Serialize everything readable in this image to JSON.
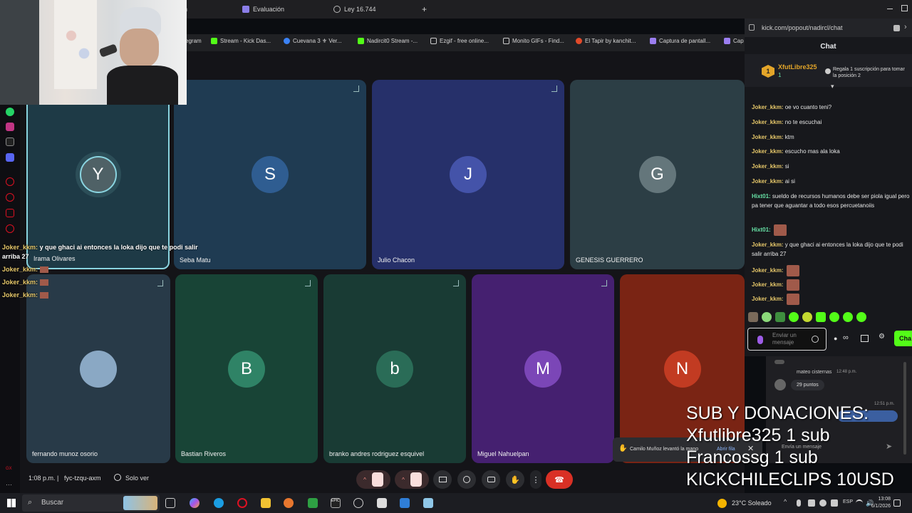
{
  "browser": {
    "tabs": [
      "n",
      "Evaluación",
      "Ley 16.744",
      "+"
    ],
    "address": "kick.com/popout/nadircl/chat",
    "bookmarks": [
      "egram",
      "Stream - Kick Das...",
      "Cuevana 3 ⚜ Ver...",
      "Nadircit0 Stream -...",
      "Ezgif - free online...",
      "Monito GIFs - Find...",
      "El Tapir by kanchit...",
      "Captura de pantall...",
      "Cap"
    ]
  },
  "meet": {
    "tiles": [
      {
        "name": "Irama Olivares",
        "initial": "Y",
        "bg": "#1e3a46",
        "avatar": "#4f6166"
      },
      {
        "name": "Seba Matu",
        "initial": "S",
        "bg": "#1f3b52",
        "avatar": "#2f5d91"
      },
      {
        "name": "Julio Chacon",
        "initial": "J",
        "bg": "#26306a",
        "avatar": "#4453a9"
      },
      {
        "name": "GENESIS GUERRERO",
        "initial": "G",
        "bg": "#2c3e45",
        "avatar": "#64767b"
      },
      {
        "name": "fernando munoz osorio",
        "initial": "",
        "bg": "#283a48",
        "avatar": "#8aa8c4"
      },
      {
        "name": "Bastian Riveros",
        "initial": "B",
        "bg": "#184436",
        "avatar": "#2f8366"
      },
      {
        "name": "branko andres rodriguez esquivel",
        "initial": "b",
        "bg": "#193b34",
        "avatar": "#2a6c57"
      },
      {
        "name": "Miguel Nahuelpan",
        "initial": "M",
        "bg": "#452070",
        "avatar": "#7b46b7"
      },
      {
        "name": "",
        "initial": "N",
        "bg": "#7a2414",
        "avatar": "#c23b22"
      }
    ],
    "time": "1:08 p.m.",
    "code": "fyc-tzqu-axm",
    "viewer": "Solo ver",
    "raise_hand_toast": "Camilo Muñoz levantó la mano",
    "toast_link": "Abrir fila",
    "side_chat": {
      "user": "mateo cisternas",
      "time1": "12:48 p.m.",
      "points": "29 puntos",
      "time2": "12:51 p.m.",
      "input": "Envía un mensaje"
    }
  },
  "overlay_chat": [
    {
      "user": "Joker_kkm:",
      "text": "y que ghaci ai entonces la loka dijo que te podi salir arriba 27"
    },
    {
      "user": "Joker_kkm:",
      "text": ""
    },
    {
      "user": "Joker_kkm:",
      "text": ""
    },
    {
      "user": "Joker_kkm:",
      "text": ""
    }
  ],
  "kick": {
    "title": "Chat",
    "top_user": "XfutLibre325",
    "top_count": "1",
    "gift_text": "Regala 1 suscripción para tomar la posición 2",
    "messages": [
      {
        "user": "Joker_kkm:",
        "text": "oe vo cuanto teni?",
        "c": "u"
      },
      {
        "user": "Joker_kkm:",
        "text": "no te escuchai",
        "c": "u"
      },
      {
        "user": "Joker_kkm:",
        "text": "ktm",
        "c": "u"
      },
      {
        "user": "Joker_kkm:",
        "text": "escucho mas ala loka",
        "c": "u"
      },
      {
        "user": "Joker_kkm:",
        "text": "si",
        "c": "u"
      },
      {
        "user": "Joker_kkm:",
        "text": "ai si",
        "c": "u"
      },
      {
        "user": "Hixt01:",
        "text": "sueldo de recursos humanos debe ser piola igual pero pa tener que aguantar a todo esos percuetanoiis",
        "c": "u2"
      },
      {
        "user": "Hixt01:",
        "text": "",
        "c": "u2"
      },
      {
        "user": "Joker_kkm:",
        "text": "y que ghaci ai entonces la loka dijo que te podi salir arriba 27",
        "c": "u"
      },
      {
        "user": "Joker_kkm:",
        "text": "",
        "c": "u"
      },
      {
        "user": "Joker_kkm:",
        "text": "",
        "c": "u"
      },
      {
        "user": "Joker_kkm:",
        "text": "",
        "c": "u"
      }
    ],
    "input_placeholder": "Enviar un mensaje",
    "send_label": "Cha"
  },
  "sub_overlay": [
    "SUB Y DONACIONES:",
    "Xfutlibre325 1 sub",
    "Francossg 1 sub",
    "KICKCHILECLIPS 10USD"
  ],
  "taskbar": {
    "search": "Buscar",
    "weather": "23°C  Soleado",
    "lang": "ESP",
    "time": "13:08",
    "date": "6/1/2026"
  }
}
